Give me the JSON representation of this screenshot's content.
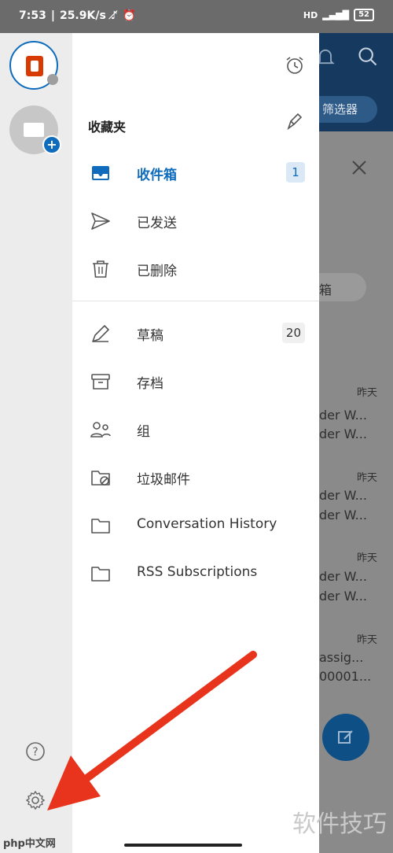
{
  "status_bar": {
    "time": "7:53",
    "speed": "25.9K/s",
    "battery": "52"
  },
  "drawer": {
    "favorites_title": "收藏夹",
    "favorites": [
      {
        "label": "收件箱",
        "badge": "1",
        "icon": "inbox-icon",
        "active": true
      },
      {
        "label": "已发送",
        "badge": "",
        "icon": "send-icon",
        "active": false
      },
      {
        "label": "已删除",
        "badge": "",
        "icon": "trash-icon",
        "active": false
      }
    ],
    "folders": [
      {
        "label": "草稿",
        "badge": "20",
        "icon": "draft-icon"
      },
      {
        "label": "存档",
        "badge": "",
        "icon": "archive-icon"
      },
      {
        "label": "组",
        "badge": "",
        "icon": "group-icon"
      },
      {
        "label": "垃圾邮件",
        "badge": "",
        "icon": "junk-folder-icon"
      },
      {
        "label": "Conversation History",
        "badge": "",
        "icon": "folder-icon"
      },
      {
        "label": "RSS Subscriptions",
        "badge": "",
        "icon": "folder-icon"
      }
    ]
  },
  "background": {
    "filter_label": "筛选器",
    "chip_label": "箱",
    "rows": [
      {
        "date": "昨天",
        "line1": "der W...",
        "line2": "der W..."
      },
      {
        "date": "昨天",
        "line1": "der W...",
        "line2": "der W..."
      },
      {
        "date": "昨天",
        "line1": "der W...",
        "line2": "der W..."
      },
      {
        "date": "昨天",
        "line1": "assig...",
        "line2": "00001..."
      }
    ]
  },
  "watermarks": {
    "right": "软件技巧",
    "left": "php中文网"
  },
  "colors": {
    "accent": "#0f6cbd",
    "arrow": "#e8341c"
  }
}
